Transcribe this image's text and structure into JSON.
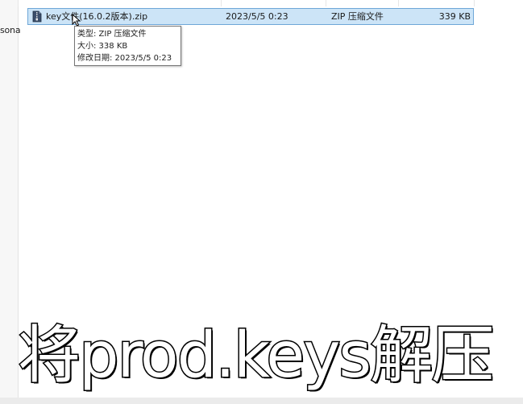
{
  "left_panel": {
    "truncated_label": "sona"
  },
  "file_row": {
    "name": "key文件(16.0.2版本).zip",
    "date_modified": "2023/5/5 0:23",
    "type": "ZIP 压缩文件",
    "size": "339 KB",
    "icon": "zip-file-icon",
    "selected": true
  },
  "tooltip": {
    "type_line": "类型: ZIP 压缩文件",
    "size_line": "大小: 338 KB",
    "date_line": "修改日期: 2023/5/5 0:23"
  },
  "caption": {
    "text": "将prod.keys解压"
  },
  "colors": {
    "selection_bg": "#cce4f7",
    "selection_border": "#6ea7d8",
    "caption_fill": "#ffffff",
    "caption_stroke": "#000000"
  }
}
